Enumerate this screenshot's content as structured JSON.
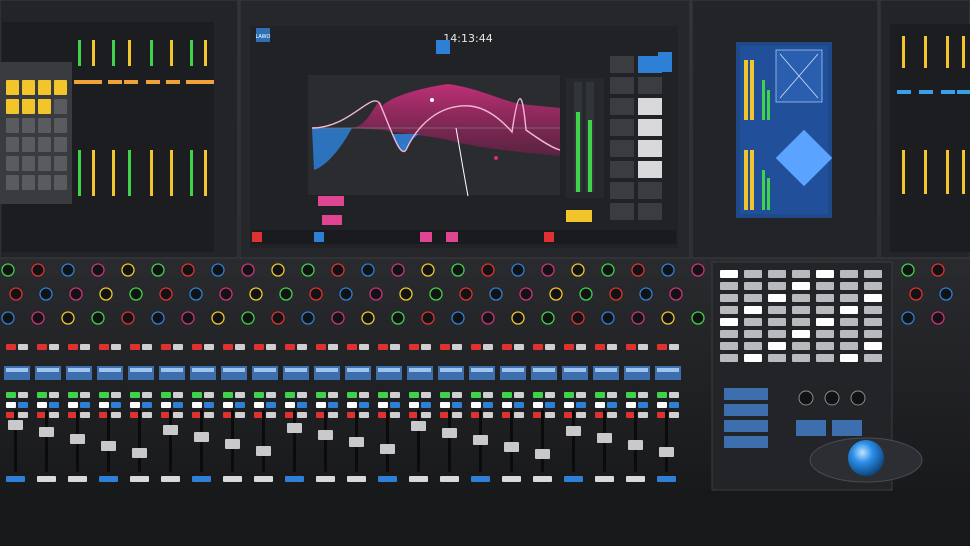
{
  "screen": {
    "clock": "14:13:44",
    "logo_text": "LAWO"
  },
  "surface": {
    "colors": {
      "eq_magenta": "#d0307f",
      "eq_blue": "#2e7fd6",
      "key_yellow": "#f2c62a",
      "trackball_blue": "#2b8fe8",
      "meter_green": "#3fd24a",
      "button_red": "#e03131",
      "screen_bg": "#202226"
    },
    "trackball_icon": "trackball-icon"
  }
}
